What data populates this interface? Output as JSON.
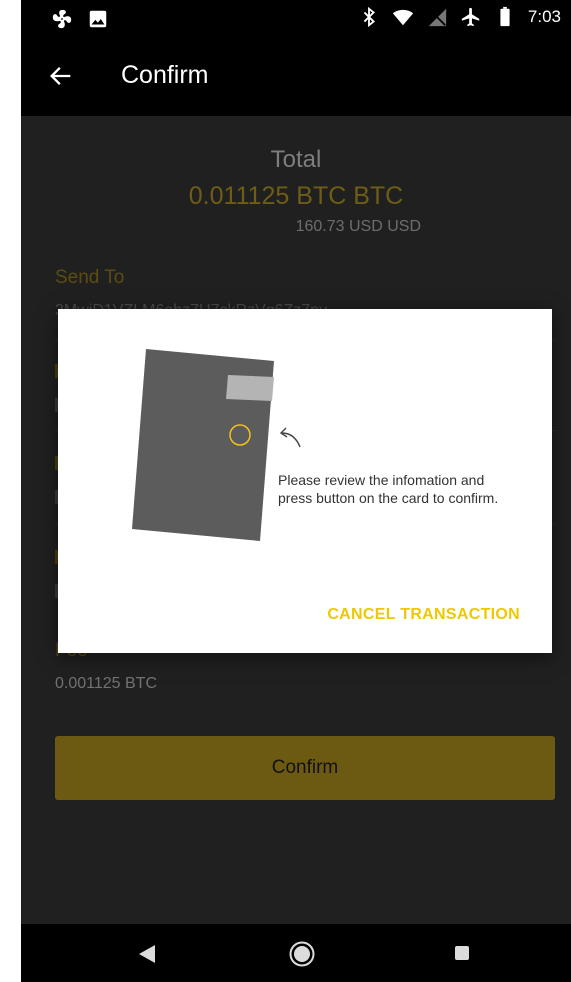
{
  "status_bar": {
    "time": "7:03",
    "left_icons": [
      "fan-icon",
      "image-icon"
    ],
    "right_icons": [
      "bluetooth-icon",
      "wifi-icon",
      "no-signal-icon",
      "airplane-icon",
      "battery-icon"
    ]
  },
  "app_bar": {
    "title": "Confirm"
  },
  "summary": {
    "total_label": "Total",
    "total_btc": "0.011125 BTC BTC",
    "total_usd": "160.73 USD USD"
  },
  "send_to": {
    "label": "Send To",
    "value": "3MwiD1VZLM6ehz7U7ckRzVq6Zz7pv..."
  },
  "fee": {
    "label": "Fee",
    "value": "0.001125 BTC"
  },
  "confirm_button": {
    "label": "Confirm"
  },
  "dialog": {
    "message": "Please review the infomation and press button on the card to confirm.",
    "cancel_label": "CANCEL TRANSACTION"
  },
  "colors": {
    "accent": "#eec900",
    "dim_accent": "#6c5912"
  }
}
